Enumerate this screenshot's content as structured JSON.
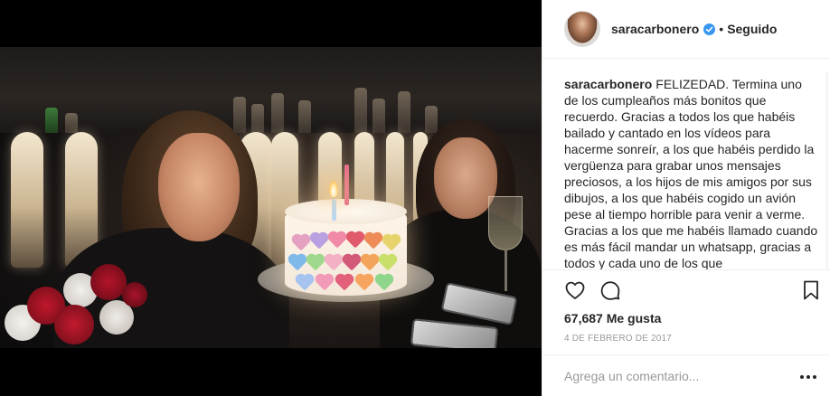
{
  "post": {
    "photo_alt": "",
    "username": "saracarbonero",
    "verified": true,
    "separator": "•",
    "follow_status": "Seguido",
    "caption_user": "saracarbonero",
    "caption_text": "FELIZEDAD. Termina uno de los cumpleaños más bonitos que recuerdo. Gracias a todos los que habéis bailado y cantado en los vídeos para hacerme sonreír, a los que habéis perdido la vergüenza para grabar unos mensajes preciosos, a los hijos de mis amigos por sus dibujos, a los que habéis cogido un avión pese al tiempo horrible para venir a verme. Gracias a los que me habéis llamado cuando es más fácil mandar un whatsapp, gracias a todos y cada uno de los que",
    "likes": "67,687 Me gusta",
    "date": "4 de febrero de 2017",
    "comment_placeholder": "Agrega un comentario...",
    "more_label": "•••"
  },
  "icons": {
    "verified": "verified-badge-icon",
    "like": "heart-icon",
    "comment": "comment-icon",
    "save": "bookmark-icon",
    "more": "more-dots-icon"
  },
  "colors": {
    "verified_blue": "#3897f0",
    "text": "#262626",
    "muted": "#999999",
    "border": "#efefef"
  }
}
